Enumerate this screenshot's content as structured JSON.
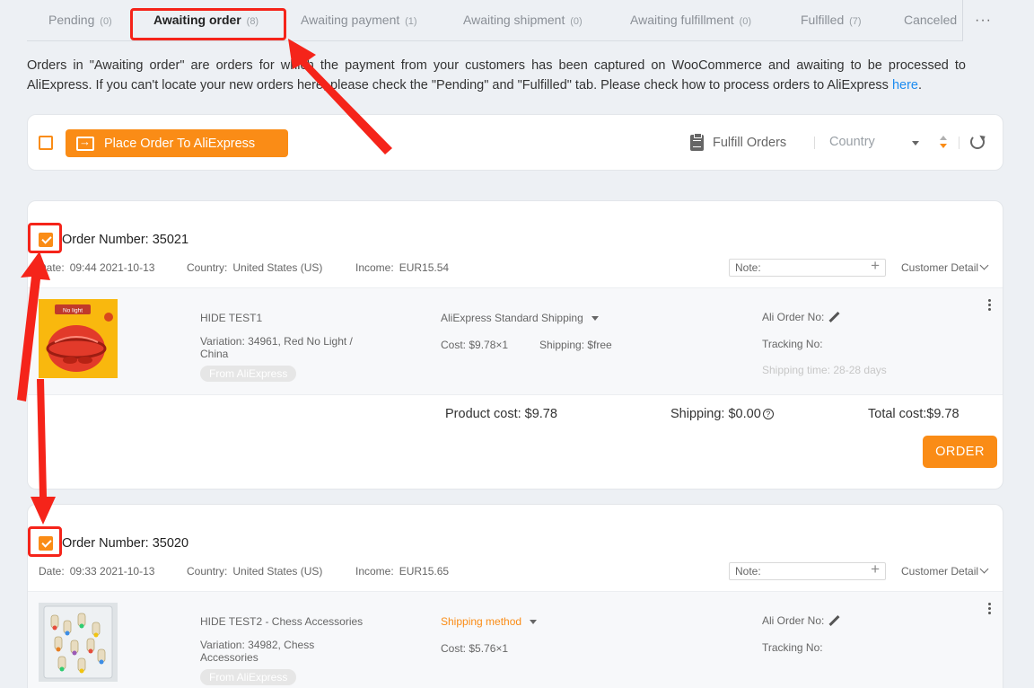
{
  "tabs": [
    {
      "label": "Pending",
      "count": "(0)"
    },
    {
      "label": "Awaiting order",
      "count": "(8)"
    },
    {
      "label": "Awaiting payment",
      "count": "(1)"
    },
    {
      "label": "Awaiting shipment",
      "count": "(0)"
    },
    {
      "label": "Awaiting fulfillment",
      "count": "(0)"
    },
    {
      "label": "Fulfilled",
      "count": "(7)"
    },
    {
      "label": "Canceled",
      "count": "("
    }
  ],
  "tabs_more": "···",
  "description": {
    "text": "Orders in \"Awaiting order\" are orders for which the payment from your customers has been captured on WooCommerce and awaiting to be processed to AliExpress. If you can't locate your new orders here, please check the \"Pending\" and \"Fulfilled\" tab. Please check how to process orders to AliExpress ",
    "link": "here",
    "end": "."
  },
  "toolbar": {
    "place_order_label": "Place Order To AliExpress",
    "fulfill_label": "Fulfill Orders",
    "country_placeholder": "Country"
  },
  "orders": [
    {
      "title": "Order Number: 35021",
      "date_label": "Date:",
      "date": "09:44 2021-10-13",
      "country_label": "Country:",
      "country": "United States (US)",
      "income_label": "Income:",
      "income": "EUR15.54",
      "note_placeholder": "Note:",
      "customer_detail": "Customer Detail",
      "product_name": "HIDE TEST1",
      "variation": "Variation: 34961, Red No Light / China",
      "source_tag": "From AliExpress",
      "shipping_method": "AliExpress Standard Shipping",
      "cost": "Cost: $9.78×1",
      "shipping": "Shipping: $free",
      "ali_order_label": "Ali Order No:",
      "tracking_label": "Tracking No:",
      "shipping_time": "Shipping time: 28-28 days",
      "product_cost": "Product cost: $9.78",
      "shipping_total": "Shipping: $0.00",
      "total_cost": "Total cost:$9.78",
      "order_button": "ORDER",
      "checked": true
    },
    {
      "title": "Order Number: 35020",
      "date_label": "Date:",
      "date": "09:33 2021-10-13",
      "country_label": "Country:",
      "country": "United States (US)",
      "income_label": "Income:",
      "income": "EUR15.65",
      "note_placeholder": "Note:",
      "customer_detail": "Customer Detail",
      "product_name": "HIDE TEST2 - Chess Accessories",
      "variation": "Variation: 34982, Chess Accessories",
      "source_tag": "From AliExpress",
      "shipping_method": "Shipping method",
      "cost": "Cost: $5.76×1",
      "ali_order_label": "Ali Order No:",
      "tracking_label": "Tracking No:",
      "checked": true
    }
  ],
  "product1_image_text": "No light",
  "colors": {
    "accent": "#fa8c16",
    "annotation": "#f5241a",
    "link": "#1d8cf0"
  }
}
